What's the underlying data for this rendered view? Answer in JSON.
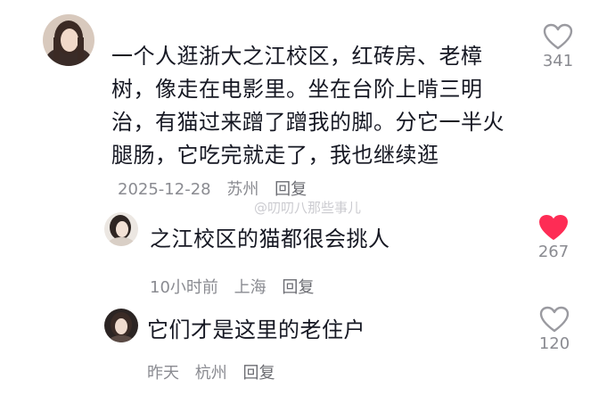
{
  "comments": [
    {
      "text_lines": [
        "一个人逛浙大之江校区，红砖房、老樟",
        "树，像走在电影里。坐在台阶上啃三明",
        "治，有猫过来蹭了蹭我的脚。分它一半火",
        "腿肠，它吃完就走了，我也继续逛"
      ],
      "date": "2025-12-28",
      "location": "苏州",
      "reply_label": "回复",
      "likes": "341",
      "liked": false
    },
    {
      "text": "之江校区的猫都很会挑人",
      "date": "10小时前",
      "location": "上海",
      "reply_label": "回复",
      "likes": "267",
      "liked": true
    },
    {
      "text": "它们才是这里的老住户",
      "date": "昨天",
      "location": "杭州",
      "reply_label": "回复",
      "likes": "120",
      "liked": false
    }
  ],
  "watermark": "@叨叨八那些事儿",
  "colors": {
    "liked": "#fe2c55",
    "icon": "#9a9aa0",
    "meta": "#8a8b91"
  },
  "icons": {
    "like": "heart-outline-icon",
    "liked": "heart-filled-icon"
  }
}
